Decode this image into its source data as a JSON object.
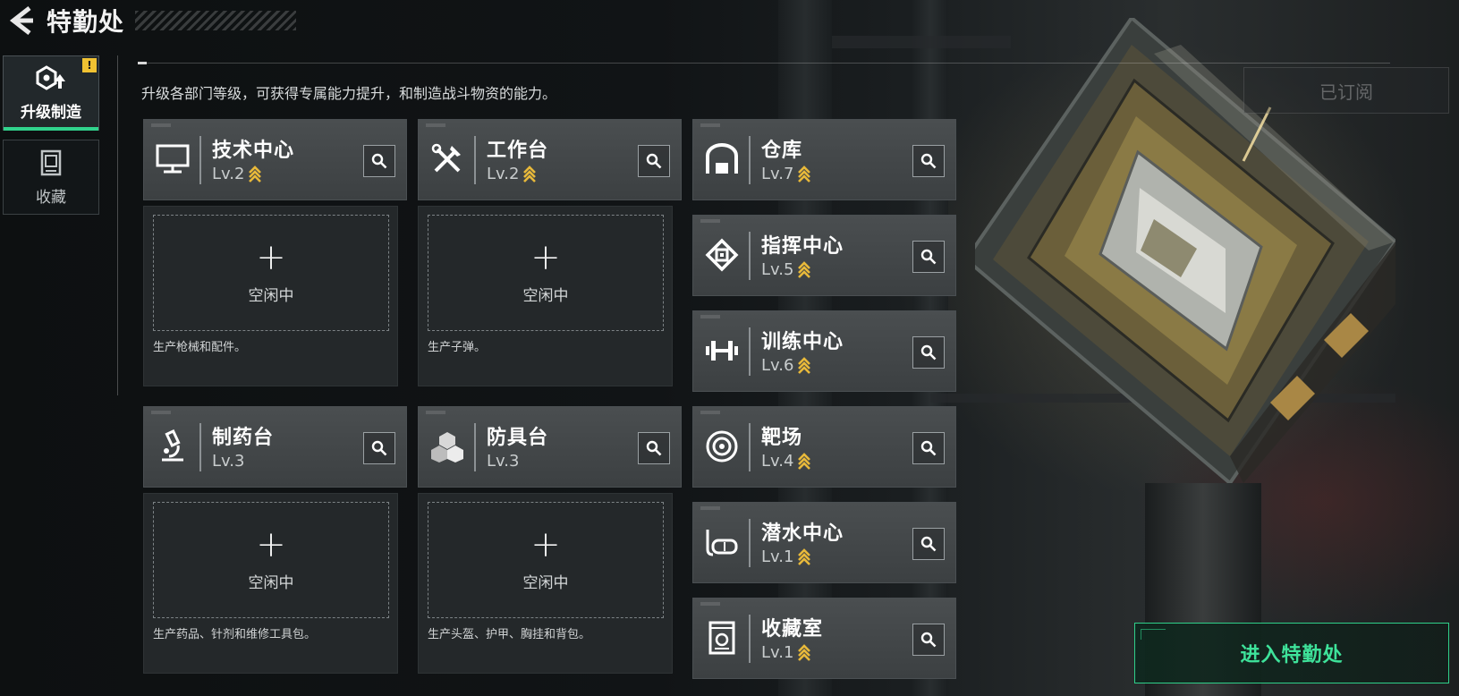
{
  "header": {
    "title": "特勤处",
    "back_icon": "back-arrow-icon"
  },
  "sidebar": {
    "tabs": [
      {
        "label": "升级制造",
        "icon": "upgrade-craft-icon",
        "active": true,
        "alert": "!"
      },
      {
        "label": "收藏",
        "icon": "collection-case-icon",
        "active": false
      }
    ]
  },
  "subtitle": "升级各部门等级，可获得专属能力提升，和制造战斗物资的能力。",
  "subscribed_label": "已订阅",
  "facilities_left": [
    {
      "name": "技术中心",
      "level": "Lv.2",
      "icon": "monitor-icon",
      "upgradeable": true,
      "slot_status": "空闲中",
      "description": "生产枪械和配件。"
    },
    {
      "name": "工作台",
      "level": "Lv.2",
      "icon": "tools-icon",
      "upgradeable": true,
      "slot_status": "空闲中",
      "description": "生产子弹。"
    },
    {
      "name": "制药台",
      "level": "Lv.3",
      "icon": "microscope-icon",
      "upgradeable": false,
      "slot_status": "空闲中",
      "description": "生产药品、针剂和维修工具包。"
    },
    {
      "name": "防具台",
      "level": "Lv.3",
      "icon": "armor-blocks-icon",
      "upgradeable": false,
      "slot_status": "空闲中",
      "description": "生产头盔、护甲、胸挂和背包。"
    }
  ],
  "facilities_right": [
    {
      "name": "仓库",
      "level": "Lv.7",
      "icon": "warehouse-icon",
      "upgradeable": true
    },
    {
      "name": "指挥中心",
      "level": "Lv.5",
      "icon": "command-chip-icon",
      "upgradeable": true
    },
    {
      "name": "训练中心",
      "level": "Lv.6",
      "icon": "dumbbell-icon",
      "upgradeable": true
    },
    {
      "name": "靶场",
      "level": "Lv.4",
      "icon": "target-icon",
      "upgradeable": true
    },
    {
      "name": "潜水中心",
      "level": "Lv.1",
      "icon": "diving-mask-icon",
      "upgradeable": true
    },
    {
      "name": "收藏室",
      "level": "Lv.1",
      "icon": "collection-room-icon",
      "upgradeable": true
    }
  ],
  "enter_button": "进入特勤处",
  "colors": {
    "accent_green": "#3ee29a",
    "upgrade_gold": "#e8b93a",
    "alert_yellow": "#f1c232"
  }
}
